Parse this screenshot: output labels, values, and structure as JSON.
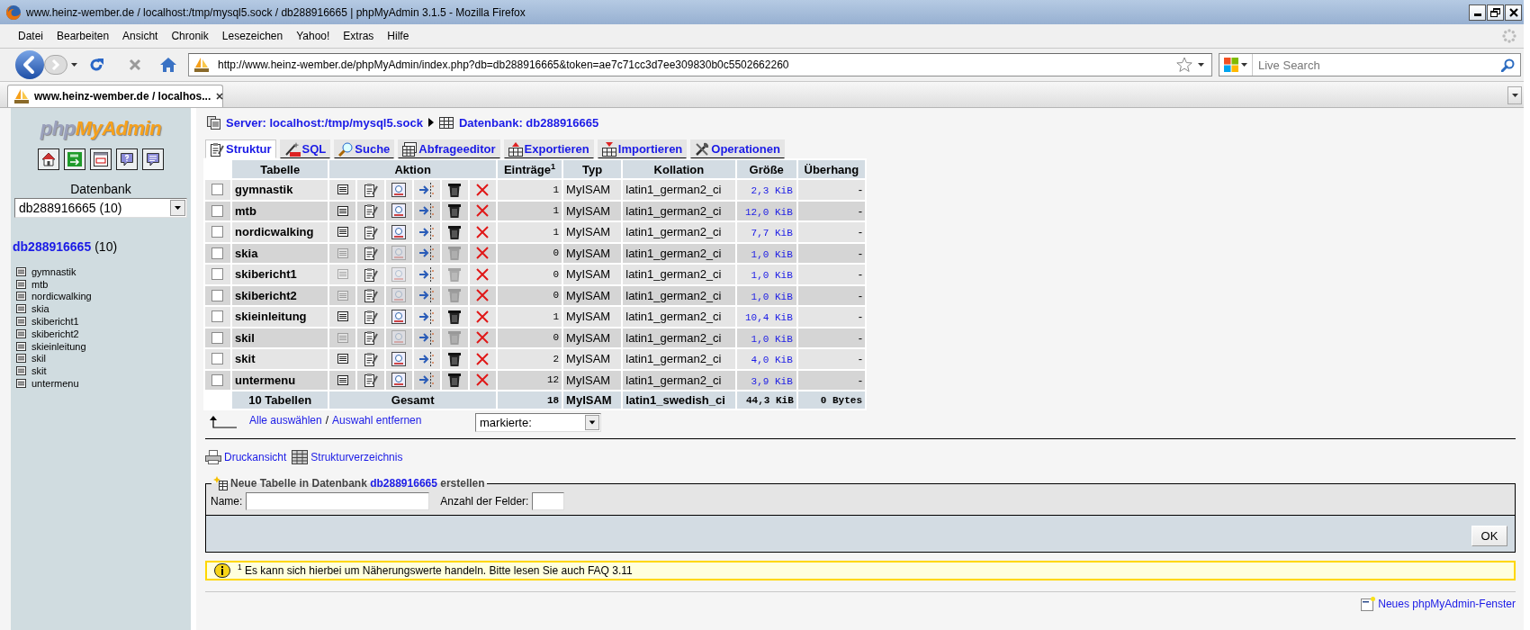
{
  "window": {
    "title": "www.heinz-wember.de / localhost:/tmp/mysql5.sock / db288916665 | phpMyAdmin 3.1.5 - Mozilla Firefox"
  },
  "menu": [
    "Datei",
    "Bearbeiten",
    "Ansicht",
    "Chronik",
    "Lesezeichen",
    "Yahoo!",
    "Extras",
    "Hilfe"
  ],
  "toolbar": {
    "url": "http://www.heinz-wember.de/phpMyAdmin/index.php?db=db288916665&token=ae7c71cc3d7ee309830b0c5502662260",
    "search": {
      "placeholder": "Live Search"
    }
  },
  "browser_tabs": [
    {
      "label": "www.heinz-wember.de / localhos...",
      "selected": true
    }
  ],
  "sidebar": {
    "logo": {
      "prefix": "php",
      "suffix": "MyAdmin"
    },
    "db_label": "Datenbank",
    "db_select": "db288916665 (10)",
    "db_link": "db288916665",
    "db_count": "(10)",
    "tables": [
      "gymnastik",
      "mtb",
      "nordicwalking",
      "skia",
      "skibericht1",
      "skibericht2",
      "skieinleitung",
      "skil",
      "skit",
      "untermenu"
    ]
  },
  "breadcrumb": {
    "server": "Server: localhost:/tmp/mysql5.sock",
    "database": "Datenbank: db288916665"
  },
  "tabs": [
    {
      "kind": "structure",
      "label": "Struktur",
      "selected": true
    },
    {
      "kind": "sql",
      "label": "SQL",
      "selected": false
    },
    {
      "kind": "search",
      "label": "Suche",
      "selected": false
    },
    {
      "kind": "query",
      "label": "Abfrageeditor",
      "selected": false
    },
    {
      "kind": "export",
      "label": "Exportieren",
      "selected": false
    },
    {
      "kind": "import",
      "label": "Importieren",
      "selected": false
    },
    {
      "kind": "operations",
      "label": "Operationen",
      "selected": false
    }
  ],
  "table": {
    "columns": [
      "Tabelle",
      "Aktion",
      "Einträge$^{1}$",
      "Typ",
      "Kollation",
      "Größe",
      "Überhang"
    ],
    "rows": [
      {
        "checked": false,
        "name": "gymnastik",
        "actions_disabled": false,
        "entries": "1",
        "type": "MyISAM",
        "collation": "latin1_german2_ci",
        "size": "2,3 KiB",
        "overhead": "-"
      },
      {
        "checked": false,
        "name": "mtb",
        "actions_disabled": false,
        "entries": "1",
        "type": "MyISAM",
        "collation": "latin1_german2_ci",
        "size": "12,0 KiB",
        "overhead": "-"
      },
      {
        "checked": false,
        "name": "nordicwalking",
        "actions_disabled": false,
        "entries": "1",
        "type": "MyISAM",
        "collation": "latin1_german2_ci",
        "size": "7,7 KiB",
        "overhead": "-"
      },
      {
        "checked": false,
        "name": "skia",
        "actions_disabled": true,
        "entries": "0",
        "type": "MyISAM",
        "collation": "latin1_german2_ci",
        "size": "1,0 KiB",
        "overhead": "-"
      },
      {
        "checked": false,
        "name": "skibericht1",
        "actions_disabled": true,
        "entries": "0",
        "type": "MyISAM",
        "collation": "latin1_german2_ci",
        "size": "1,0 KiB",
        "overhead": "-"
      },
      {
        "checked": false,
        "name": "skibericht2",
        "actions_disabled": true,
        "entries": "0",
        "type": "MyISAM",
        "collation": "latin1_german2_ci",
        "size": "1,0 KiB",
        "overhead": "-"
      },
      {
        "checked": false,
        "name": "skieinleitung",
        "actions_disabled": false,
        "entries": "1",
        "type": "MyISAM",
        "collation": "latin1_german2_ci",
        "size": "10,4 KiB",
        "overhead": "-"
      },
      {
        "checked": false,
        "name": "skil",
        "actions_disabled": true,
        "entries": "0",
        "type": "MyISAM",
        "collation": "latin1_german2_ci",
        "size": "1,0 KiB",
        "overhead": "-"
      },
      {
        "checked": false,
        "name": "skit",
        "actions_disabled": false,
        "entries": "2",
        "type": "MyISAM",
        "collation": "latin1_german2_ci",
        "size": "4,0 KiB",
        "overhead": "-"
      },
      {
        "checked": false,
        "name": "untermenu",
        "actions_disabled": false,
        "entries": "12",
        "type": "MyISAM",
        "collation": "latin1_german2_ci",
        "size": "3,9 KiB",
        "overhead": "-"
      }
    ],
    "footer": {
      "name": "10 Tabellen",
      "label": "Gesamt",
      "entries": "18",
      "type": "MyISAM",
      "collation": "latin1_swedish_ci",
      "size": "44,3 KiB",
      "overhead": "0 Bytes"
    }
  },
  "selection": {
    "select_all": "Alle auswählen",
    "separator": "/",
    "deselect_all": "Auswahl entfernen",
    "with_selected": "markierte:"
  },
  "links": [
    {
      "kind": "print",
      "label": "Druckansicht"
    },
    {
      "kind": "dictionary",
      "label": "Strukturverzeichnis"
    }
  ],
  "create_table": {
    "legend_prefix": "Neue Tabelle in Datenbank",
    "legend_db": "db288916665",
    "legend_suffix": "erstellen",
    "name_label": "Name:",
    "fields_label": "Anzahl der Felder:",
    "button": "OK"
  },
  "notice": "$^{1}$ Es kann sich hierbei um Näherungswerte handeln. Bitte lesen Sie auch FAQ 3.11",
  "new_window_link": "Neues phpMyAdmin-Fenster"
}
